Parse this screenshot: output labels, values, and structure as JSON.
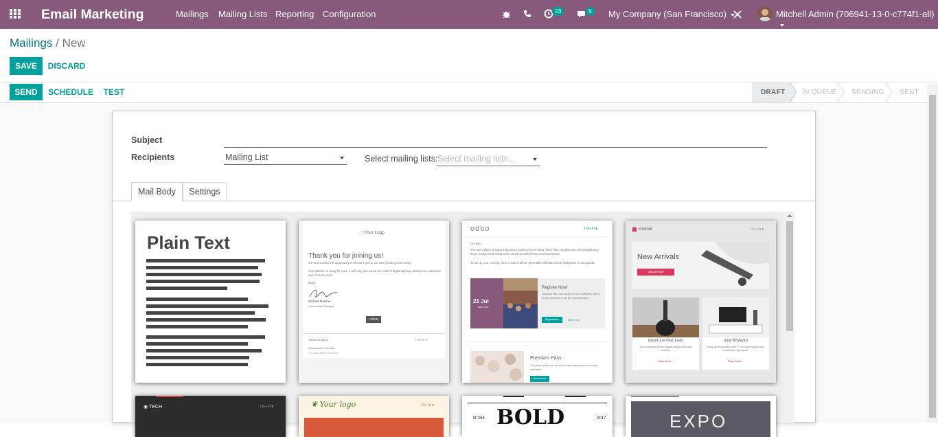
{
  "app": {
    "title": "Email Marketing"
  },
  "nav": {
    "items": [
      {
        "label": "Mailings"
      },
      {
        "label": "Mailing Lists"
      },
      {
        "label": "Reporting"
      },
      {
        "label": "Configuration"
      }
    ]
  },
  "systray": {
    "activities_count": "23",
    "messages_count": "5",
    "company": "My Company (San Francisco)",
    "user": "Mitchell Admin (706941-13-0-c774f1-all)"
  },
  "breadcrumb": {
    "parent": "Mailings",
    "separator": "/",
    "current": "New"
  },
  "buttons": {
    "save": "SAVE",
    "discard": "DISCARD",
    "send": "SEND",
    "schedule": "SCHEDULE",
    "test": "TEST"
  },
  "stages": [
    {
      "label": "DRAFT"
    },
    {
      "label": "IN QUEUE"
    },
    {
      "label": "SENDING"
    },
    {
      "label": "SENT"
    }
  ],
  "form": {
    "subject_label": "Subject",
    "subject_value": "",
    "recipients_label": "Recipients",
    "recipients_value": "Mailing List",
    "mailing_lists_label": "Select mailing lists:",
    "mailing_lists_placeholder": "Select mailing lists..."
  },
  "tabs": [
    {
      "label": "Mail Body"
    },
    {
      "label": "Settings"
    }
  ],
  "templates": {
    "plain_text": {
      "title": "Plain Text"
    },
    "welcome": {
      "logo": "Your Logo",
      "heading": "Thank you for joining us!",
      "p1": "We want to take this opportunity to welcome you to our ever-growing community!",
      "p2": "Your platform is ready for work. It will help you reduce the costs of digital signage, attract new customers and increase sales.",
      "p3": "Enjoy,",
      "signer": "Michael Fletcher",
      "signer_role": "Community Manager",
      "button": "LOGIN",
      "company": "YourCompany",
      "links": "Unsubscribe | Contact",
      "rights": "© 2018 All Rights Reserved"
    },
    "event": {
      "logo": "odoo",
      "greeting": "Hi there!",
      "p1": "The next edition of Odoo Experience looks very promising. More than 150 talks are scheduled during those 3 days! Find below some stand-out talks for the Business tracks.",
      "p2": "To stir up your curiosity, have a look at all the great talks scheduled and highlighted in our agenda!",
      "date": "21 Jul",
      "allday": "ALL DAY",
      "register_title": "Register Now!",
      "register_text": "Discover the new version of our software, with a great overview on all the new features.",
      "register_btn": "Registration",
      "more_info": "More info",
      "pass_title": "Premium Pass",
      "pass_text": "The pass gives you access to the catering and evening activities!",
      "pass_btn": "Read More"
    },
    "shop": {
      "brand": "Airmail",
      "new_arrivals": "New Arrivals",
      "discover": "DISCOVER",
      "product1": "Gibson Les Paul Junior",
      "product1_desc": "Check the top electric guitar brands and their models!",
      "product2": "Sony BDVE210",
      "product2_desc": "Hook up this product with TV and get ready for an immersive experience.",
      "read_more": "Read More..."
    },
    "tech": {
      "label": "TECH"
    },
    "yourlogo": {
      "label": "Your logo"
    },
    "bold": {
      "label": "BOLD",
      "issue": "N°258",
      "year": "2017"
    },
    "expo": {
      "label": "EXPO"
    }
  },
  "colors": {
    "topbar": "#875a7b",
    "accent": "#00a09d",
    "badge": "#00a09d"
  }
}
